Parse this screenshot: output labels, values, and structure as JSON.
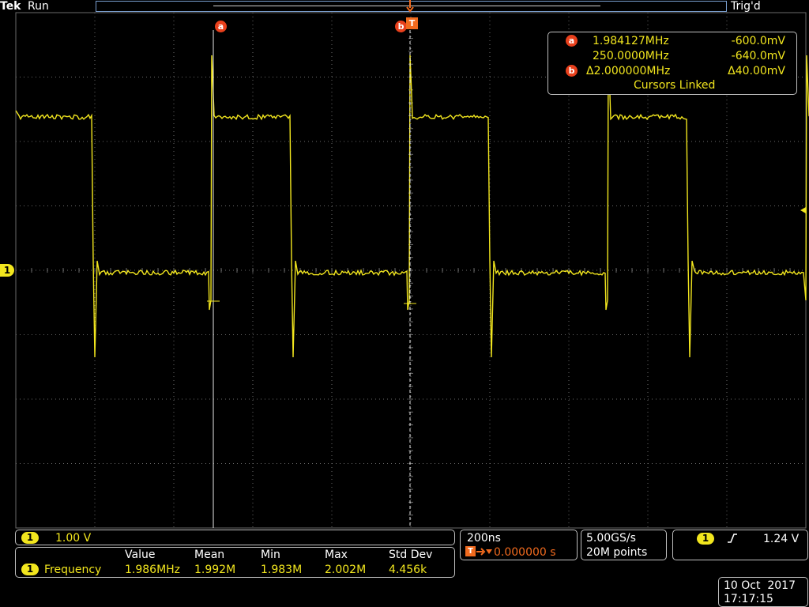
{
  "header": {
    "brand": "Tek",
    "run_state": "Run",
    "trigger_state": "Trig'd"
  },
  "cursors": {
    "a_label": "a",
    "b_label": "b",
    "trigger_marker": "T",
    "readout": {
      "a_freq": "1.984127MHz",
      "a_volt": "-600.0mV",
      "b_freq": "250.0000MHz",
      "b_volt": "-640.0mV",
      "delta_freq": "Δ2.000000MHz",
      "delta_volt": "Δ40.00mV",
      "linked": "Cursors Linked"
    }
  },
  "channel": {
    "number": "1",
    "scale": "1.00 V"
  },
  "measurement": {
    "headers": [
      "Value",
      "Mean",
      "Min",
      "Max",
      "Std Dev"
    ],
    "label": "Frequency",
    "values": [
      "1.986MHz",
      "1.992M",
      "1.983M",
      "2.002M",
      "4.456k"
    ]
  },
  "timebase": {
    "scale": "200ns",
    "delay": "0.000000 s"
  },
  "acquisition": {
    "sample_rate": "5.00GS/s",
    "record_length": "20M points"
  },
  "trigger": {
    "source": "1",
    "slope_icon": "rising-edge-icon",
    "level": "1.24 V"
  },
  "datetime": {
    "date": "10 Oct  2017",
    "time": "17:17:15"
  },
  "colors": {
    "trace": "#f2e61e",
    "cursor_marker": "#e8401c",
    "trigger_delay": "#f06a1e",
    "grid": "#6a6a6a"
  }
}
